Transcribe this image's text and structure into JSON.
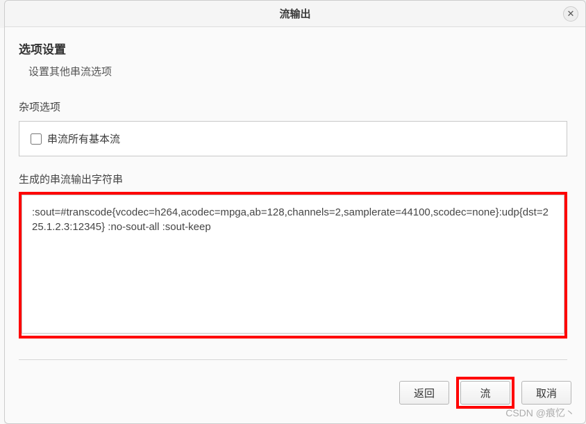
{
  "dialog": {
    "title": "流输出",
    "close_glyph": "✕"
  },
  "options": {
    "heading": "选项设置",
    "subtitle": "设置其他串流选项"
  },
  "misc": {
    "label": "杂项选项",
    "checkbox_label": "串流所有基本流",
    "checkbox_checked": false
  },
  "output": {
    "label": "生成的串流输出字符串",
    "value": ":sout=#transcode{vcodec=h264,acodec=mpga,ab=128,channels=2,samplerate=44100,scodec=none}:udp{dst=225.1.2.3:12345} :no-sout-all :sout-keep"
  },
  "buttons": {
    "back": "返回",
    "stream": "流",
    "cancel": "取消"
  },
  "watermark": "CSDN @痕忆丶"
}
